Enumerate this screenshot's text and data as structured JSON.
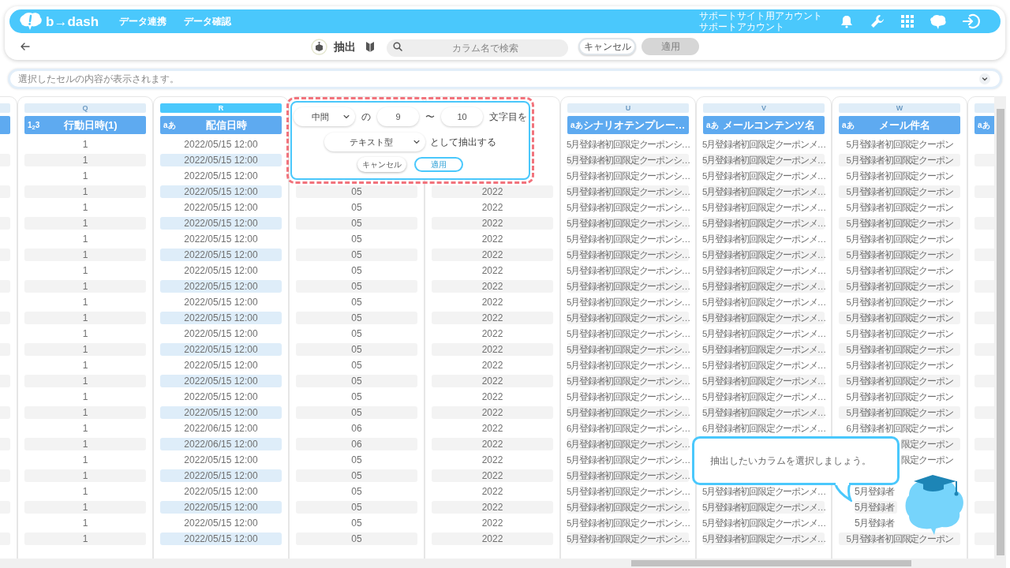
{
  "header": {
    "logo": "b→dash",
    "nav": [
      {
        "label": "データ連携"
      },
      {
        "label": "データ確認"
      }
    ],
    "account": [
      "サポートサイト用アカウント",
      "サポートアカウント"
    ]
  },
  "toolbar": {
    "title": "抽出",
    "search_placeholder": "カラム名で検索",
    "cancel": "キャンセル",
    "apply": {
      "label": "適用",
      "disabled": true
    }
  },
  "cell_bar": {
    "placeholder": "選択したセルの内容が表示されます。"
  },
  "columns": [
    {
      "kind": "partial",
      "selected": false
    },
    {
      "kind": "full",
      "letter": "Q",
      "badge": "1$_{2}$3",
      "name": "行動日時(1)",
      "selected": false,
      "cells": [
        "1",
        "1",
        "1",
        "1",
        "1",
        "1",
        "1",
        "1",
        "1",
        "1",
        "1",
        "1",
        "1",
        "1",
        "1",
        "1",
        "1",
        "1",
        "1",
        "1",
        "1",
        "1",
        "1",
        "1",
        "1",
        "1"
      ]
    },
    {
      "kind": "full",
      "letter": "R",
      "badge": "aあ",
      "name": "配信日時",
      "selected": true,
      "cells": [
        "2022/05/15 12:00",
        "2022/05/15 12:00",
        "2022/05/15 12:00",
        "2022/05/15 12:00",
        "2022/05/15 12:00",
        "2022/05/15 12:00",
        "2022/05/15 12:00",
        "2022/05/15 12:00",
        "2022/05/15 12:00",
        "2022/05/15 12:00",
        "2022/05/15 12:00",
        "2022/05/15 12:00",
        "2022/05/15 12:00",
        "2022/05/15 12:00",
        "2022/05/15 12:00",
        "2022/05/15 12:00",
        "2022/05/15 12:00",
        "2022/05/15 12:00",
        "2022/06/15 12:00",
        "2022/06/15 12:00",
        "2022/05/15 12:00",
        "2022/05/15 12:00",
        "2022/05/15 12:00",
        "2022/05/15 12:00",
        "2022/05/15 12:00",
        "2022/05/15 12:00"
      ]
    },
    {
      "kind": "covered",
      "cells": [
        null,
        null,
        null,
        "05",
        "05",
        "05",
        "05",
        "05",
        "05",
        "05",
        "05",
        "05",
        "05",
        "05",
        "05",
        "05",
        "05",
        "05",
        "06",
        "06",
        "05",
        "05",
        "05",
        "05",
        "05",
        "05"
      ]
    },
    {
      "kind": "covered",
      "cells": [
        null,
        null,
        null,
        "2022",
        "2022",
        "2022",
        "2022",
        "2022",
        "2022",
        "2022",
        "2022",
        "2022",
        "2022",
        "2022",
        "2022",
        "2022",
        "2022",
        "2022",
        "2022",
        "2022",
        "2022",
        "2022",
        "2022",
        "2022",
        "2022",
        "2022"
      ]
    },
    {
      "kind": "full",
      "letter": "U",
      "badge": "aあ",
      "name": "シナリオテンプレー…",
      "selected": false,
      "cells": [
        "5月登録者初回限定クーポンシ…",
        "5月登録者初回限定クーポンシ…",
        "5月登録者初回限定クーポンシ…",
        "5月登録者初回限定クーポンシ…",
        "5月登録者初回限定クーポンシ…",
        "5月登録者初回限定クーポンシ…",
        "5月登録者初回限定クーポンシ…",
        "5月登録者初回限定クーポンシ…",
        "5月登録者初回限定クーポンシ…",
        "5月登録者初回限定クーポンシ…",
        "5月登録者初回限定クーポンシ…",
        "5月登録者初回限定クーポンシ…",
        "5月登録者初回限定クーポンシ…",
        "5月登録者初回限定クーポンシ…",
        "5月登録者初回限定クーポンシ…",
        "5月登録者初回限定クーポンシ…",
        "5月登録者初回限定クーポンシ…",
        "5月登録者初回限定クーポンシ…",
        "6月登録者初回限定クーポンシ…",
        "6月登録者初回限定クーポンシ…",
        "5月登録者初回限定クーポンシ…",
        "5月登録者初回限定クーポンシ…",
        "5月登録者初回限定クーポンシ…",
        "5月登録者初回限定クーポンシ…",
        "5月登録者初回限定クーポンシ…",
        "5月登録者初回限定クーポンシ…"
      ]
    },
    {
      "kind": "full",
      "letter": "V",
      "badge": "aあ",
      "name": "メールコンテンツ名",
      "selected": false,
      "cells": [
        "5月登録者初回限定クーポンメ…",
        "5月登録者初回限定クーポンメ…",
        "5月登録者初回限定クーポンメ…",
        "5月登録者初回限定クーポンメ…",
        "5月登録者初回限定クーポンメ…",
        "5月登録者初回限定クーポンメ…",
        "5月登録者初回限定クーポンメ…",
        "5月登録者初回限定クーポンメ…",
        "5月登録者初回限定クーポンメ…",
        "5月登録者初回限定クーポンメ…",
        "5月登録者初回限定クーポンメ…",
        "5月登録者初回限定クーポンメ…",
        "5月登録者初回限定クーポンメ…",
        "5月登録者初回限定クーポンメ…",
        "5月登録者初回限定クーポンメ…",
        "5月登録者初回限定クーポンメ…",
        "5月登録者初回限定クーポンメ…",
        "5月登録者初回限定クーポンメ…",
        "6月登録者初回限定クーポンメ…",
        null,
        null,
        null,
        "5月登録者初回限定クーポンメ…",
        "5月登録者初回限定クーポンメ…",
        "5月登録者初回限定クーポンメ…",
        "5月登録者初回限定クーポンメ…"
      ]
    },
    {
      "kind": "full",
      "letter": "W",
      "badge": "aあ",
      "name": "メール件名",
      "selected": false,
      "cells": [
        "5月登録者初回限定クーポン",
        "5月登録者初回限定クーポン",
        "5月登録者初回限定クーポン",
        "5月登録者初回限定クーポン",
        "5月登録者初回限定クーポン",
        "5月登録者初回限定クーポン",
        "5月登録者初回限定クーポン",
        "5月登録者初回限定クーポン",
        "5月登録者初回限定クーポン",
        "5月登録者初回限定クーポン",
        "5月登録者初回限定クーポン",
        "5月登録者初回限定クーポン",
        "5月登録者初回限定クーポン",
        "5月登録者初回限定クーポン",
        "5月登録者初回限定クーポン",
        "5月登録者初回限定クーポン",
        "5月登録者初回限定クーポン",
        "5月登録者初回限定クーポン",
        "6月登録者初回限定クーポン",
        {
          "text": "限定クーポン",
          "kind": "clip_end"
        },
        {
          "text": "限定クーポン",
          "kind": "clip_end"
        },
        null,
        {
          "text": "5月登録者",
          "kind": "clip_start"
        },
        {
          "text": "5月登録者",
          "kind": "clip_start"
        },
        {
          "text": "5月登録者",
          "kind": "clip_start"
        },
        "5月登録者初回限定クーポン"
      ]
    },
    {
      "kind": "partial",
      "badge": "aあ",
      "selected": false
    }
  ],
  "extract_popup": {
    "position": "中間",
    "particle": "の",
    "from": "9",
    "tilde": "〜",
    "to": "10",
    "suffix": "文字目を",
    "type": "テキスト型",
    "type_suffix": "として抽出する",
    "cancel": "キャンセル",
    "apply": "適用"
  },
  "hint": {
    "text": "抽出したいカラムを選択しましょう。"
  }
}
